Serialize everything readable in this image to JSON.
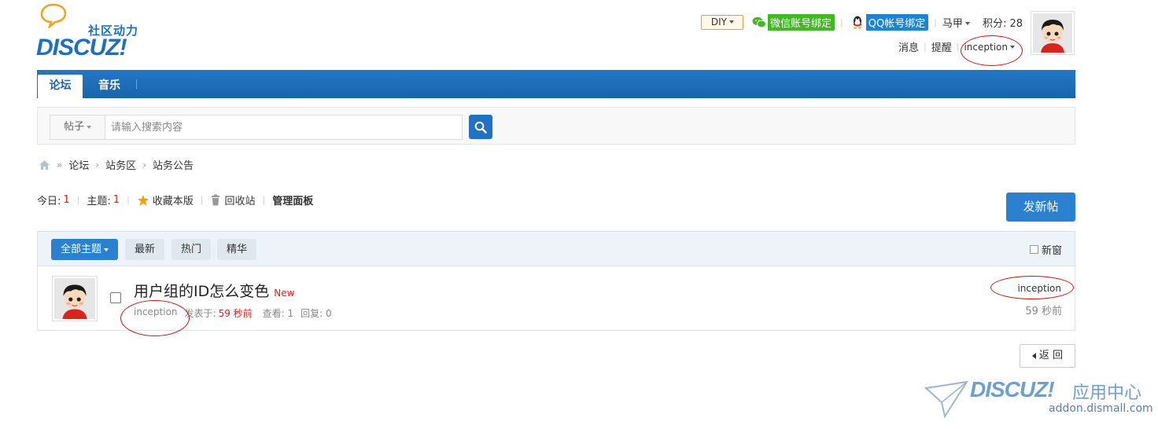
{
  "header": {
    "tagline": "社区动力",
    "brand": "DISCUZ!",
    "diy_label": "DIY",
    "wechat_bind": "微信账号绑定",
    "qq_bind": "QQ帐号绑定",
    "username": "马甲",
    "points_label": "积分: 28",
    "messages": "消息",
    "reminders": "提醒",
    "account_menu": "inception"
  },
  "nav": {
    "tabs": [
      {
        "label": "论坛",
        "active": true
      },
      {
        "label": "音乐",
        "active": false
      }
    ]
  },
  "search": {
    "scope": "帖子",
    "placeholder": "请输入搜索内容"
  },
  "breadcrumb": [
    "论坛",
    "站务区",
    "站务公告"
  ],
  "stats": {
    "today_label": "今日:",
    "today_value": "1",
    "topics_label": "主题:",
    "topics_value": "1",
    "favorite": "收藏本版",
    "recycle": "回收站",
    "manage": "管理面板"
  },
  "new_post_button": "发新帖",
  "thread_filters": [
    "全部主题",
    "最新",
    "热门",
    "精华"
  ],
  "new_window_label": "新窗",
  "threads": [
    {
      "title": "用户组的ID怎么变色",
      "new_tag": "New",
      "author": "inception",
      "posted_label": "发表于:",
      "posted_time": "59 秒前",
      "views_label": "查看: 1",
      "replies_label": "回复: 0",
      "last_user": "inception",
      "last_time": "59 秒前"
    }
  ],
  "back_button": "返 回",
  "watermark": {
    "brand": "DISCUZ!",
    "cn": "应用中心",
    "url": "addon.dismall.com"
  },
  "colors": {
    "primary": "#2c80d0",
    "nav": "#1a63ac",
    "highlight_ring": "#d01010",
    "wechat": "#42b826",
    "qq": "#1d84d3"
  }
}
